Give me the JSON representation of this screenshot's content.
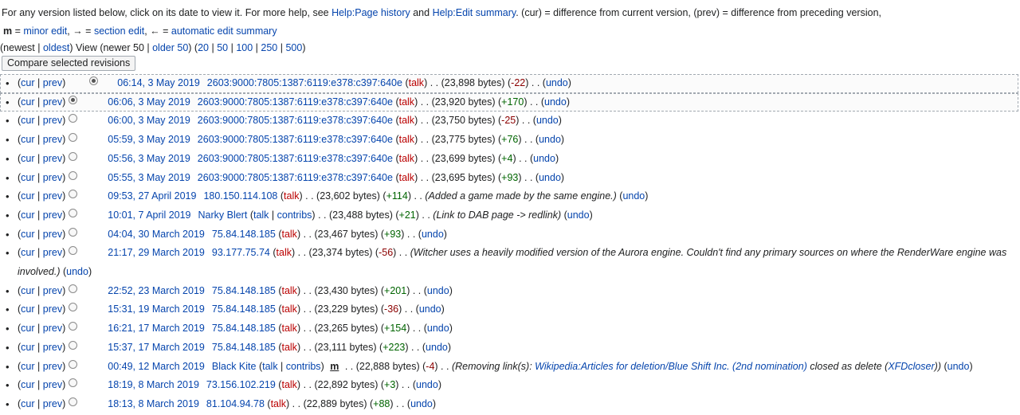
{
  "intro": {
    "t1": "For any version listed below, click on its date to view it. For more help, see ",
    "help_history": "Help:Page history",
    "t2": " and ",
    "help_summary": "Help:Edit summary",
    "t3": ". (cur) = difference from current version, (prev) = difference from preceding version,",
    "m": "m",
    "t4": " = ",
    "minor_edit": "minor edit",
    "t5": ", → = ",
    "section_edit": "section edit",
    "t6": ", ← = ",
    "auto_summary": "automatic edit summary"
  },
  "pager": {
    "open": "(",
    "newest": "newest",
    "bar": " | ",
    "oldest": "oldest",
    "view": ") View (newer 50 | ",
    "older": "older 50",
    "sep": ") (",
    "n20": "20",
    "n50": "50",
    "n100": "100",
    "n250": "250",
    "n500": "500",
    "close": ")"
  },
  "compare_button": "Compare selected revisions",
  "labels": {
    "cur": "cur",
    "prev": "prev",
    "talk": "talk",
    "contribs": "contribs",
    "undo": "undo",
    "minor": "m"
  },
  "revisions": [
    {
      "date": "06:14, 3 May 2019",
      "user": "2603:9000:7805:1387:6119:e378:c397:640e",
      "size": "23,898 bytes",
      "diff": "-22"
    },
    {
      "date": "06:06, 3 May 2019",
      "user": "2603:9000:7805:1387:6119:e378:c397:640e",
      "size": "23,920 bytes",
      "diff": "+170"
    },
    {
      "date": "06:00, 3 May 2019",
      "user": "2603:9000:7805:1387:6119:e378:c397:640e",
      "size": "23,750 bytes",
      "diff": "-25"
    },
    {
      "date": "05:59, 3 May 2019",
      "user": "2603:9000:7805:1387:6119:e378:c397:640e",
      "size": "23,775 bytes",
      "diff": "+76"
    },
    {
      "date": "05:56, 3 May 2019",
      "user": "2603:9000:7805:1387:6119:e378:c397:640e",
      "size": "23,699 bytes",
      "diff": "+4"
    },
    {
      "date": "05:55, 3 May 2019",
      "user": "2603:9000:7805:1387:6119:e378:c397:640e",
      "size": "23,695 bytes",
      "diff": "+93"
    },
    {
      "date": "09:53, 27 April 2019",
      "user": "180.150.114.108",
      "size": "23,602 bytes",
      "diff": "+114",
      "summary": "Added a game made by the same engine."
    },
    {
      "date": "10:01, 7 April 2019",
      "user": "Narky Blert",
      "size": "23,488 bytes",
      "diff": "+21",
      "summary": "Link to DAB page -> redlink"
    },
    {
      "date": "04:04, 30 March 2019",
      "user": "75.84.148.185",
      "size": "23,467 bytes",
      "diff": "+93"
    },
    {
      "date": "21:17, 29 March 2019",
      "user": "93.177.75.74",
      "size": "23,374 bytes",
      "diff": "-56",
      "summary": "Witcher uses a heavily modified version of the Aurora engine. Couldn't find any primary sources on where the RenderWare engine was involved."
    },
    {
      "date": "22:52, 23 March 2019",
      "user": "75.84.148.185",
      "size": "23,430 bytes",
      "diff": "+201"
    },
    {
      "date": "15:31, 19 March 2019",
      "user": "75.84.148.185",
      "size": "23,229 bytes",
      "diff": "-36"
    },
    {
      "date": "16:21, 17 March 2019",
      "user": "75.84.148.185",
      "size": "23,265 bytes",
      "diff": "+154"
    },
    {
      "date": "15:37, 17 March 2019",
      "user": "75.84.148.185",
      "size": "23,111 bytes",
      "diff": "+223"
    },
    {
      "date": "00:49, 12 March 2019",
      "user": "Black Kite",
      "size": "22,888 bytes",
      "diff": "-4",
      "summary_pre": "Removing link(s): ",
      "summary_link": "Wikipedia:Articles for deletion/Blue Shift Inc. (2nd nomination)",
      "summary_mid": " closed as delete (",
      "summary_tool": "XFDcloser",
      "summary_post": ")"
    },
    {
      "date": "18:19, 8 March 2019",
      "user": "73.156.102.219",
      "size": "22,892 bytes",
      "diff": "+3"
    },
    {
      "date": "18:13, 8 March 2019",
      "user": "81.104.94.78",
      "size": "22,889 bytes",
      "diff": "+88"
    }
  ]
}
